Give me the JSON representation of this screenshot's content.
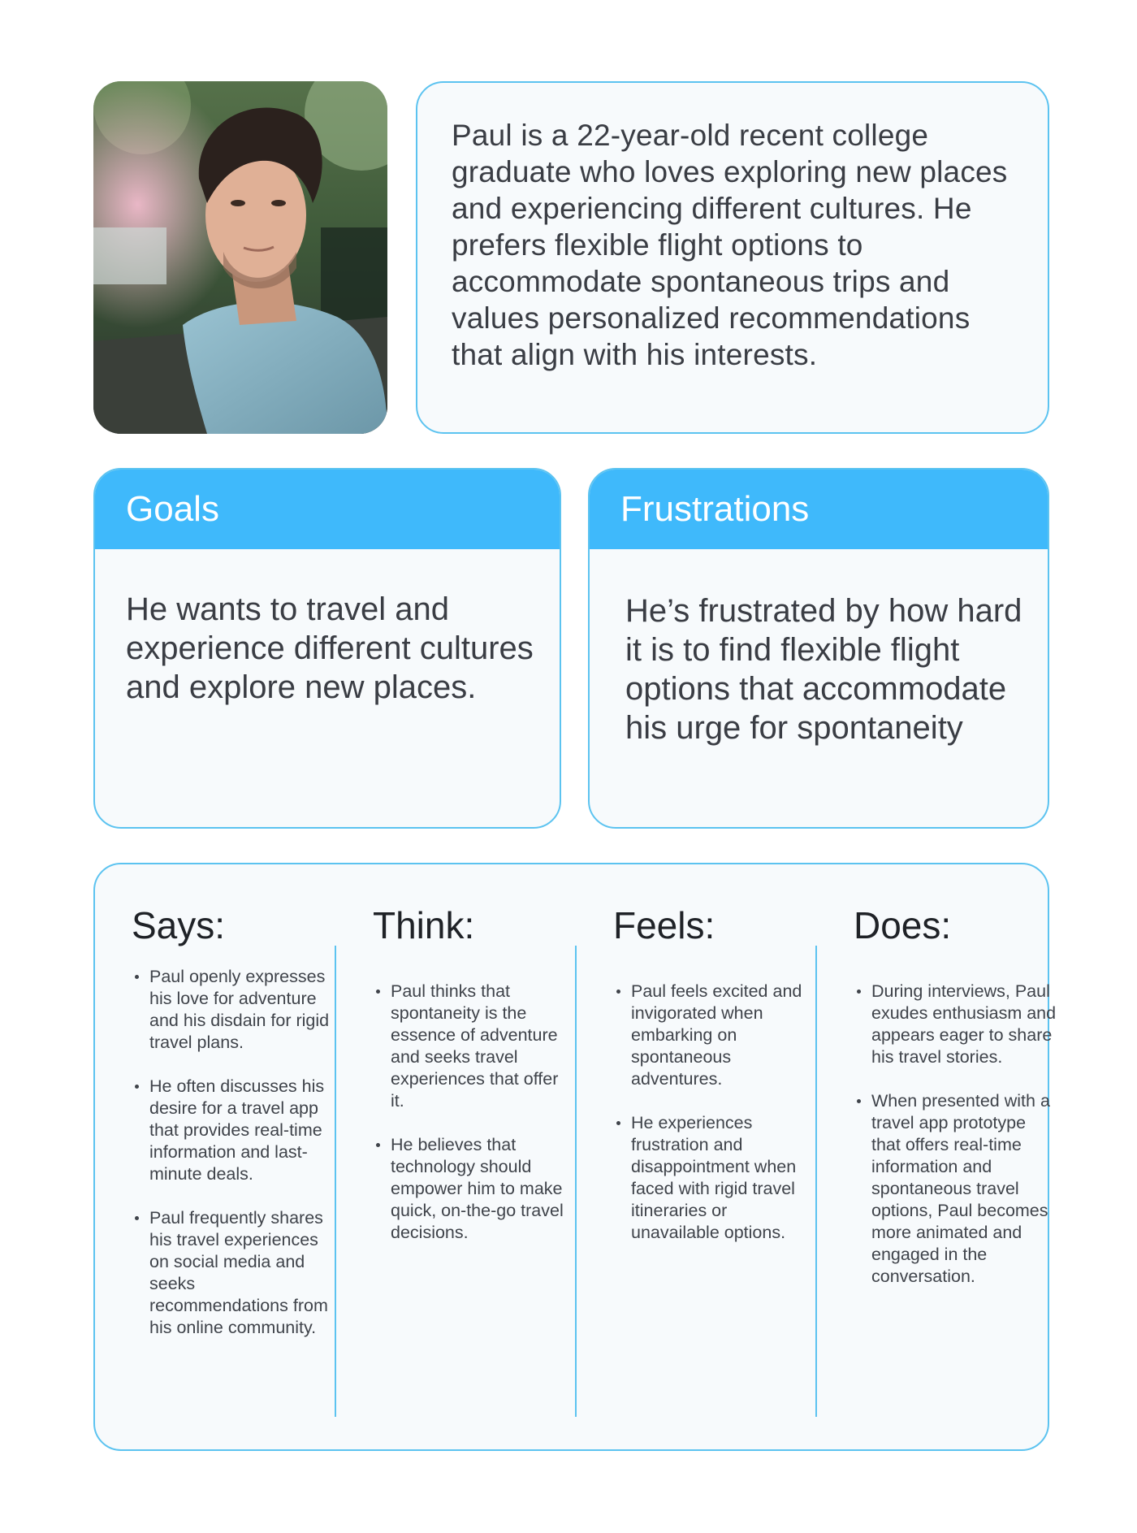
{
  "persona": {
    "photo_icon": "portrait-photo",
    "bio": "Paul is a 22-year-old recent college graduate who loves exploring new places and experiencing different cultures. He prefers flexible flight options to accommodate spontaneous trips and values personalized recommendations that align with his interests."
  },
  "goals": {
    "title": "Goals",
    "text": "He wants to travel and experience different cultures and explore new places."
  },
  "frustrations": {
    "title": "Frustrations",
    "text": "He’s frustrated by how hard it is to find flexible flight options that accommodate his urge for spontaneity"
  },
  "empathy": {
    "says": {
      "title": "Says:",
      "items": [
        "Paul openly expresses his love for adventure and his disdain for rigid travel plans.",
        "He often discusses his desire for a travel app that provides real-time information and last-minute deals.",
        "Paul frequently shares his travel experiences on social media and seeks recommendations from his online community."
      ]
    },
    "think": {
      "title": "Think:",
      "items": [
        "Paul thinks that spontaneity is the essence of adventure and seeks travel experiences that offer it.",
        "He believes that technology should empower him to make quick, on-the-go travel decisions."
      ]
    },
    "feels": {
      "title": "Feels:",
      "items": [
        "Paul feels excited and invigorated when embarking on spontaneous adventures.",
        "He experiences frustration and disappointment when faced with rigid travel itineraries or unavailable options."
      ]
    },
    "does": {
      "title": "Does:",
      "items": [
        "During interviews, Paul exudes enthusiasm and appears eager to share his travel stories.",
        "When presented with a travel app prototype that offers real-time information and spontaneous travel options, Paul becomes more animated and engaged in the conversation."
      ]
    }
  },
  "colors": {
    "accent": "#3fb9fb",
    "border": "#5cc3f0",
    "card_bg": "#f7fafc"
  }
}
